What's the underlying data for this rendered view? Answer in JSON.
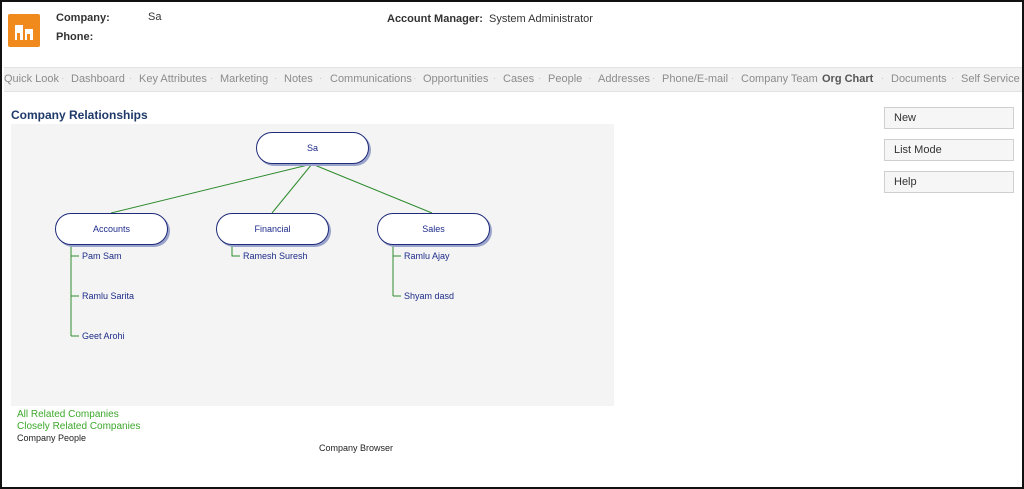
{
  "header": {
    "company_label": "Company:",
    "company_value": "Sa",
    "phone_label": "Phone:",
    "account_manager_label": "Account Manager:",
    "account_manager_value": "System Administrator"
  },
  "tabs": [
    {
      "label": "Quick Look"
    },
    {
      "label": "Dashboard"
    },
    {
      "label": "Key Attributes"
    },
    {
      "label": "Marketing"
    },
    {
      "label": "Notes"
    },
    {
      "label": "Communications"
    },
    {
      "label": "Opportunities"
    },
    {
      "label": "Cases"
    },
    {
      "label": "People"
    },
    {
      "label": "Addresses"
    },
    {
      "label": "Phone/E-mail"
    },
    {
      "label": "Company Team"
    },
    {
      "label": "Org Chart",
      "active": true
    },
    {
      "label": "Documents"
    },
    {
      "label": "Self Service"
    }
  ],
  "section_title": "Company Relationships",
  "org_chart": {
    "root": "Sa",
    "departments": [
      {
        "name": "Accounts",
        "members": [
          "Pam Sam",
          "Ramlu Sarita",
          "Geet Arohi"
        ]
      },
      {
        "name": "Financial",
        "members": [
          "Ramesh Suresh"
        ]
      },
      {
        "name": "Sales",
        "members": [
          "Ramlu Ajay",
          "Shyam dasd"
        ]
      }
    ],
    "colors": {
      "connector": "#2e8b2e",
      "node_border": "#1e2a7a",
      "text": "#1d2b8a"
    }
  },
  "actions": {
    "new": "New",
    "list_mode": "List Mode",
    "help": "Help"
  },
  "links": {
    "all_related": "All Related Companies",
    "closely_related": "Closely Related Companies",
    "company_people": "Company People",
    "company_browser": "Company Browser"
  },
  "colors": {
    "accent": "#f08a1c",
    "title": "#1f3a6a",
    "link_green": "#3da82b"
  }
}
